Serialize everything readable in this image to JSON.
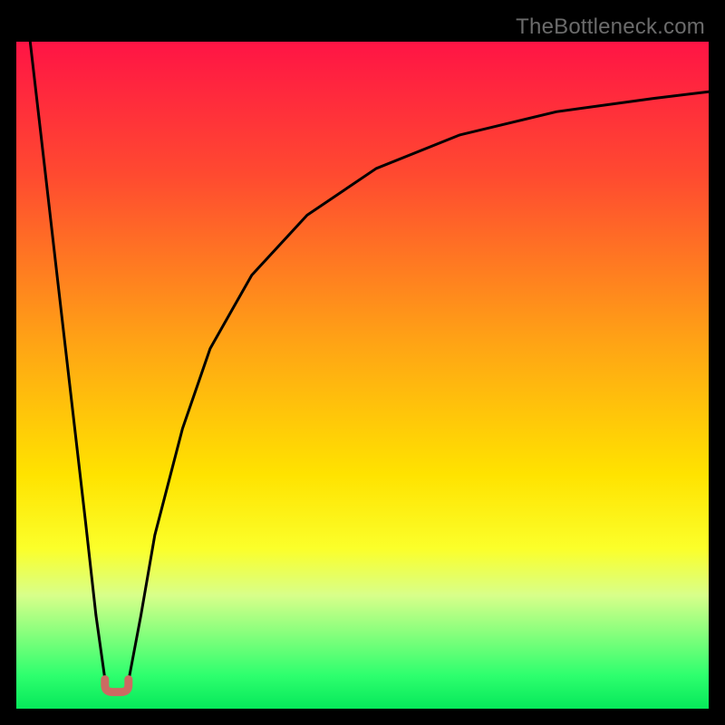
{
  "watermark": "TheBottleneck.com",
  "chart_data": {
    "type": "line",
    "title": "",
    "xlabel": "",
    "ylabel": "",
    "xlim": [
      0,
      100
    ],
    "ylim": [
      0,
      100
    ],
    "background_gradient": {
      "stops": [
        {
          "offset": 0.0,
          "color": "#ff1445"
        },
        {
          "offset": 0.2,
          "color": "#ff4a30"
        },
        {
          "offset": 0.45,
          "color": "#ffa315"
        },
        {
          "offset": 0.65,
          "color": "#ffe300"
        },
        {
          "offset": 0.76,
          "color": "#fbff2a"
        },
        {
          "offset": 0.83,
          "color": "#d8ff8a"
        },
        {
          "offset": 0.95,
          "color": "#2eff6e"
        },
        {
          "offset": 1.0,
          "color": "#06e85a"
        }
      ]
    },
    "annotations": [
      {
        "type": "marker",
        "name": "bottleneck-marker",
        "x": 14.5,
        "y": 2.5,
        "color": "#cc6a62"
      }
    ],
    "series": [
      {
        "name": "left-branch",
        "x": [
          2.0,
          4.0,
          6.0,
          8.0,
          10.0,
          11.5,
          13.0
        ],
        "y": [
          100,
          82,
          64,
          46,
          28,
          14,
          3.0
        ]
      },
      {
        "name": "right-branch",
        "x": [
          16.0,
          18.0,
          20.0,
          24.0,
          28.0,
          34.0,
          42.0,
          52.0,
          64.0,
          78.0,
          92.0,
          100.0
        ],
        "y": [
          3.0,
          14,
          26,
          42,
          54,
          65,
          74,
          81,
          86,
          89.5,
          91.5,
          92.5
        ]
      }
    ]
  }
}
